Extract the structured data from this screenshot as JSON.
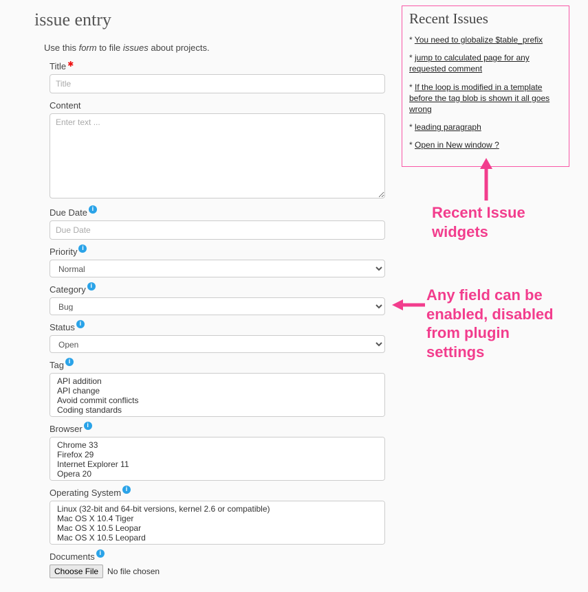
{
  "page": {
    "title": "issue entry",
    "intro_pre": "Use this ",
    "intro_form": "form",
    "intro_mid": " to file ",
    "intro_issues": "issues",
    "intro_post": " about projects."
  },
  "form": {
    "title": {
      "label": "Title",
      "placeholder": "Title",
      "required": true
    },
    "content": {
      "label": "Content",
      "placeholder": "Enter text ..."
    },
    "due_date": {
      "label": "Due Date",
      "placeholder": "Due Date"
    },
    "priority": {
      "label": "Priority",
      "value": "Normal"
    },
    "category": {
      "label": "Category",
      "value": "Bug"
    },
    "status": {
      "label": "Status",
      "value": "Open"
    },
    "tag": {
      "label": "Tag",
      "options": [
        "API addition",
        "API change",
        "Avoid commit conflicts",
        "Coding standards"
      ]
    },
    "browser": {
      "label": "Browser",
      "options": [
        "Chrome 33",
        "Firefox 29",
        "Internet Explorer 11",
        "Opera 20"
      ]
    },
    "os": {
      "label": "Operating System",
      "options": [
        "Linux (32-bit and 64-bit versions, kernel 2.6 or compatible)",
        "Mac OS X 10.4 Tiger",
        "Mac OS X 10.5 Leopar",
        "Mac OS X 10.5 Leopard"
      ]
    },
    "documents": {
      "label": "Documents",
      "button": "Choose File",
      "status": "No file chosen"
    }
  },
  "sidebar": {
    "title": "Recent Issues",
    "items": [
      "You need to globalize $table_prefix",
      "jump to calculated page for any requested comment",
      "If the loop is modified in a template before the tag blob is shown it all goes wrong",
      "leading paragraph",
      "Open in New window ?"
    ]
  },
  "annotations": {
    "a1": "Recent Issue widgets",
    "a2": "Any field can be enabled, disabled from plugin settings"
  },
  "info_glyph": "i"
}
